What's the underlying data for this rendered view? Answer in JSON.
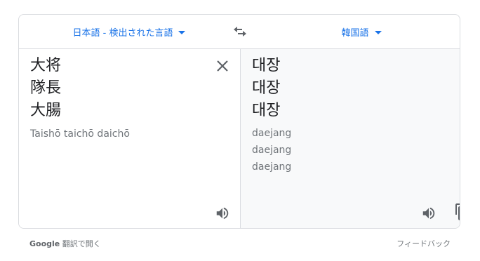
{
  "header": {
    "source_language": "日本語 - 検出された言語",
    "target_language": "韓国語"
  },
  "source": {
    "lines": [
      "大将",
      "隊長",
      "大腸"
    ],
    "romanization": "Taishō taichō daichō"
  },
  "target": {
    "lines": [
      "대장",
      "대장",
      "대장"
    ],
    "romanization": [
      "daejang",
      "daejang",
      "daejang"
    ]
  },
  "footer": {
    "open_brand": "Google",
    "open_label": "翻訳で開く",
    "feedback": "フィードバック"
  },
  "icons": {
    "swap": "swap-icon",
    "clear": "close-icon",
    "listen_source": "volume-icon",
    "listen_target": "volume-icon",
    "copy": "copy-icon",
    "dropdown": "caret-down-icon"
  },
  "colors": {
    "accent": "#1a73e8",
    "border": "#dadce0",
    "target_bg": "#f8f9fa",
    "icon": "#5f6368"
  }
}
